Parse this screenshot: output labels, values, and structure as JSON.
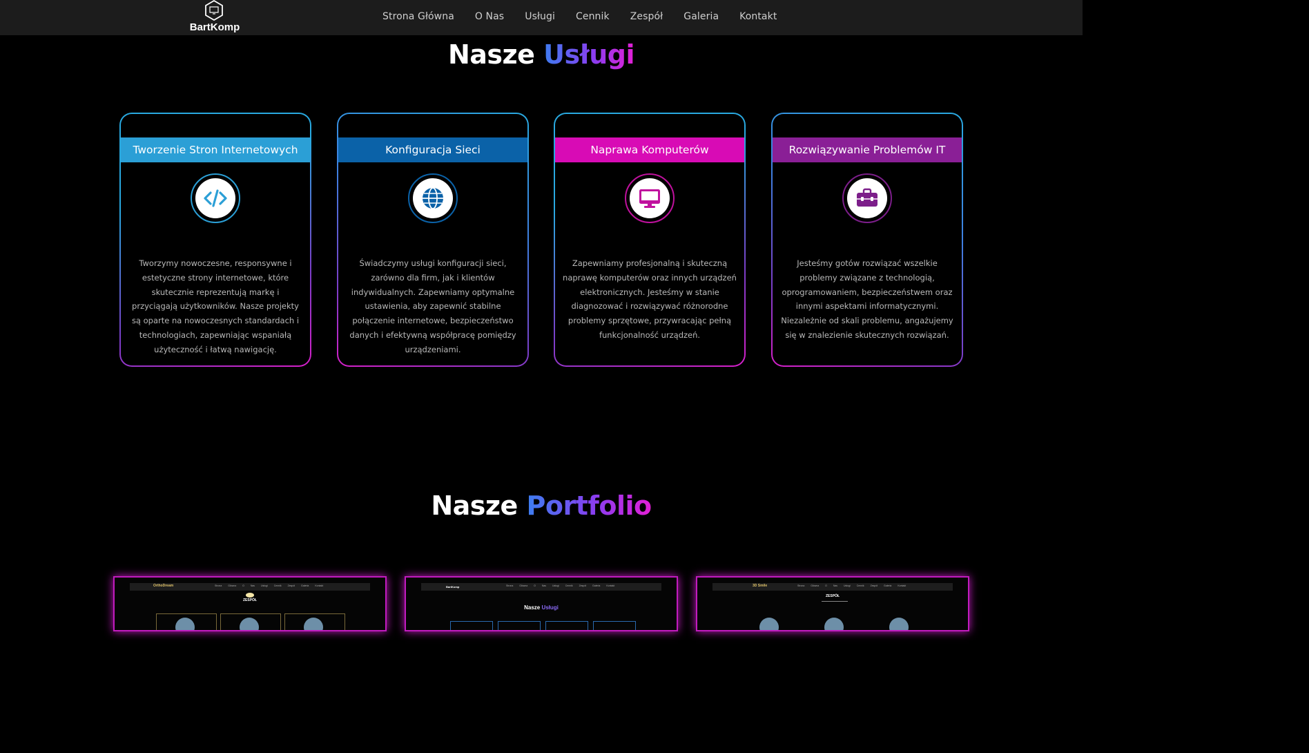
{
  "header": {
    "logo_text": "BartKomp",
    "nav": [
      "Strona Główna",
      "O Nas",
      "Usługi",
      "Cennik",
      "Zespół",
      "Galeria",
      "Kontakt"
    ]
  },
  "services": {
    "title_plain": "Nasze",
    "title_accent": "Usługi",
    "cards": [
      {
        "title": "Tworzenie Stron Internetowych",
        "icon": "code-icon",
        "header_color": "#2b9fd6",
        "icon_color": "#2b9fd6",
        "description": "Tworzymy nowoczesne, responsywne i estetyczne strony internetowe, które skutecznie reprezentują markę i przyciągają użytkowników. Nasze projekty są oparte na nowoczesnych standardach i technologiach, zapewniając wspaniałą użyteczność i łatwą nawigację."
      },
      {
        "title": "Konfiguracja Sieci",
        "icon": "globe-icon",
        "header_color": "#0b62a8",
        "icon_color": "#0b62a8",
        "description": "Świadczymy usługi konfiguracji sieci, zarówno dla firm, jak i klientów indywidualnych. Zapewniamy optymalne ustawienia, aby zapewnić stabilne połączenie internetowe, bezpieczeństwo danych i efektywną współpracę pomiędzy urządzeniami."
      },
      {
        "title": "Naprawa Komputerów",
        "icon": "monitor-icon",
        "header_color": "#d80bb5",
        "icon_color": "#c0119e",
        "description": "Zapewniamy profesjonalną i skuteczną naprawę komputerów oraz innych urządzeń elektronicznych. Jesteśmy w stanie diagnozować i rozwiązywać różnorodne problemy sprzętowe, przywracając pełną funkcjonalność urządzeń."
      },
      {
        "title": "Rozwiązywanie Problemów IT",
        "icon": "toolbox-icon",
        "header_color": "#8a1f96",
        "icon_color": "#7c1e8a",
        "description": "Jesteśmy gotów rozwiązać wszelkie problemy związane z technologią, oprogramowaniem, bezpieczeństwem oraz innymi aspektami informatycznymi. Niezależnie od skali problemu, angażujemy się w znalezienie skutecznych rozwiązań."
      }
    ]
  },
  "portfolio": {
    "title_plain": "Nasze",
    "title_accent": "Portfolio",
    "thumbs": [
      {
        "brand": "OrthoDream",
        "brand_color": "#e0c36a",
        "heading": "ZESPÓŁ",
        "nav": "Strona Główna O Nas Usługi Cennik Zespół Galeria Kontakt"
      },
      {
        "brand": "BartKomp",
        "brand_color": "#ffffff",
        "heading_plain": "Nasze",
        "heading_accent": "Usługi",
        "nav": "Strona Główna O Nas Usługi Cennik Zespół Galeria Kontakt"
      },
      {
        "brand": "3D Smile",
        "brand_color": "#e0c36a",
        "heading": "ZESPÓŁ",
        "nav": "Strona Główna O Nas Usługi Cennik Zespół Galeria Kontakt"
      }
    ]
  }
}
